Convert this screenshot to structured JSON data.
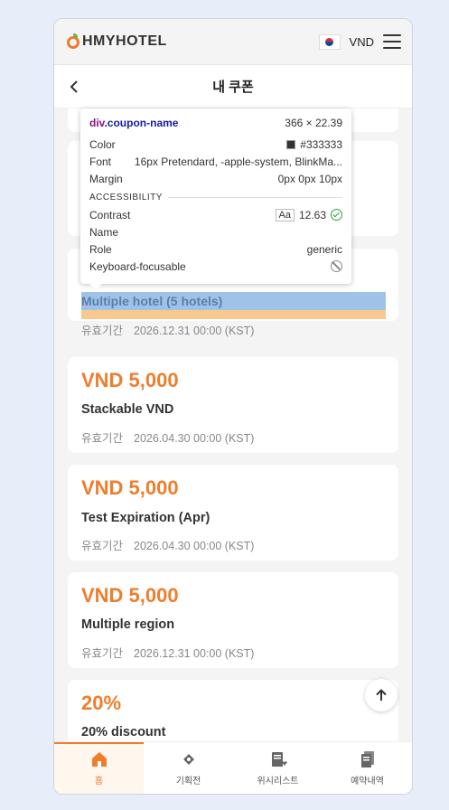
{
  "topbar": {
    "logo_text": "HMYHOTEL",
    "currency": "VND",
    "flag_icon": "korea-flag-icon",
    "menu_icon": "hamburger-icon"
  },
  "header": {
    "title": "내 쿠폰",
    "back_icon": "chevron-left-icon"
  },
  "coupons": [
    {
      "amount": "",
      "name": "Multiple hotel (5 hotels)",
      "validity_label": "유효기간",
      "validity_date": "2026.12.31 00:00 (KST)"
    },
    {
      "amount": "VND 5,000",
      "name": "Stackable VND",
      "validity_label": "유효기간",
      "validity_date": "2026.04.30 00:00 (KST)"
    },
    {
      "amount": "VND 5,000",
      "name": "Test Expiration (Apr)",
      "validity_label": "유효기간",
      "validity_date": "2026.04.30 00:00 (KST)"
    },
    {
      "amount": "VND 5,000",
      "name": "Multiple region",
      "validity_label": "유효기간",
      "validity_date": "2026.12.31 00:00 (KST)"
    },
    {
      "amount": "20%",
      "name": "20% discount",
      "validity_label": "",
      "validity_date": ""
    }
  ],
  "inspector": {
    "tag": "div",
    "class": ".coupon-name",
    "dimensions": "366 × 22.39",
    "color_label": "Color",
    "color_value": "#333333",
    "font_label": "Font",
    "font_value": "16px Pretendard, -apple-system, BlinkMa...",
    "margin_label": "Margin",
    "margin_value": "0px 0px 10px",
    "section": "ACCESSIBILITY",
    "contrast_label": "Contrast",
    "contrast_aa": "Aa",
    "contrast_value": "12.63",
    "name_label": "Name",
    "role_label": "Role",
    "role_value": "generic",
    "focus_label": "Keyboard-focusable"
  },
  "bottom_nav": [
    {
      "label": "홈",
      "icon": "home-icon",
      "active": true
    },
    {
      "label": "기획전",
      "icon": "ticket-icon",
      "active": false
    },
    {
      "label": "위시리스트",
      "icon": "wishlist-icon",
      "active": false
    },
    {
      "label": "예약내역",
      "icon": "reservations-icon",
      "active": false
    }
  ],
  "colors": {
    "accent": "#ef7d2c",
    "text": "#333333",
    "muted": "#888888"
  }
}
